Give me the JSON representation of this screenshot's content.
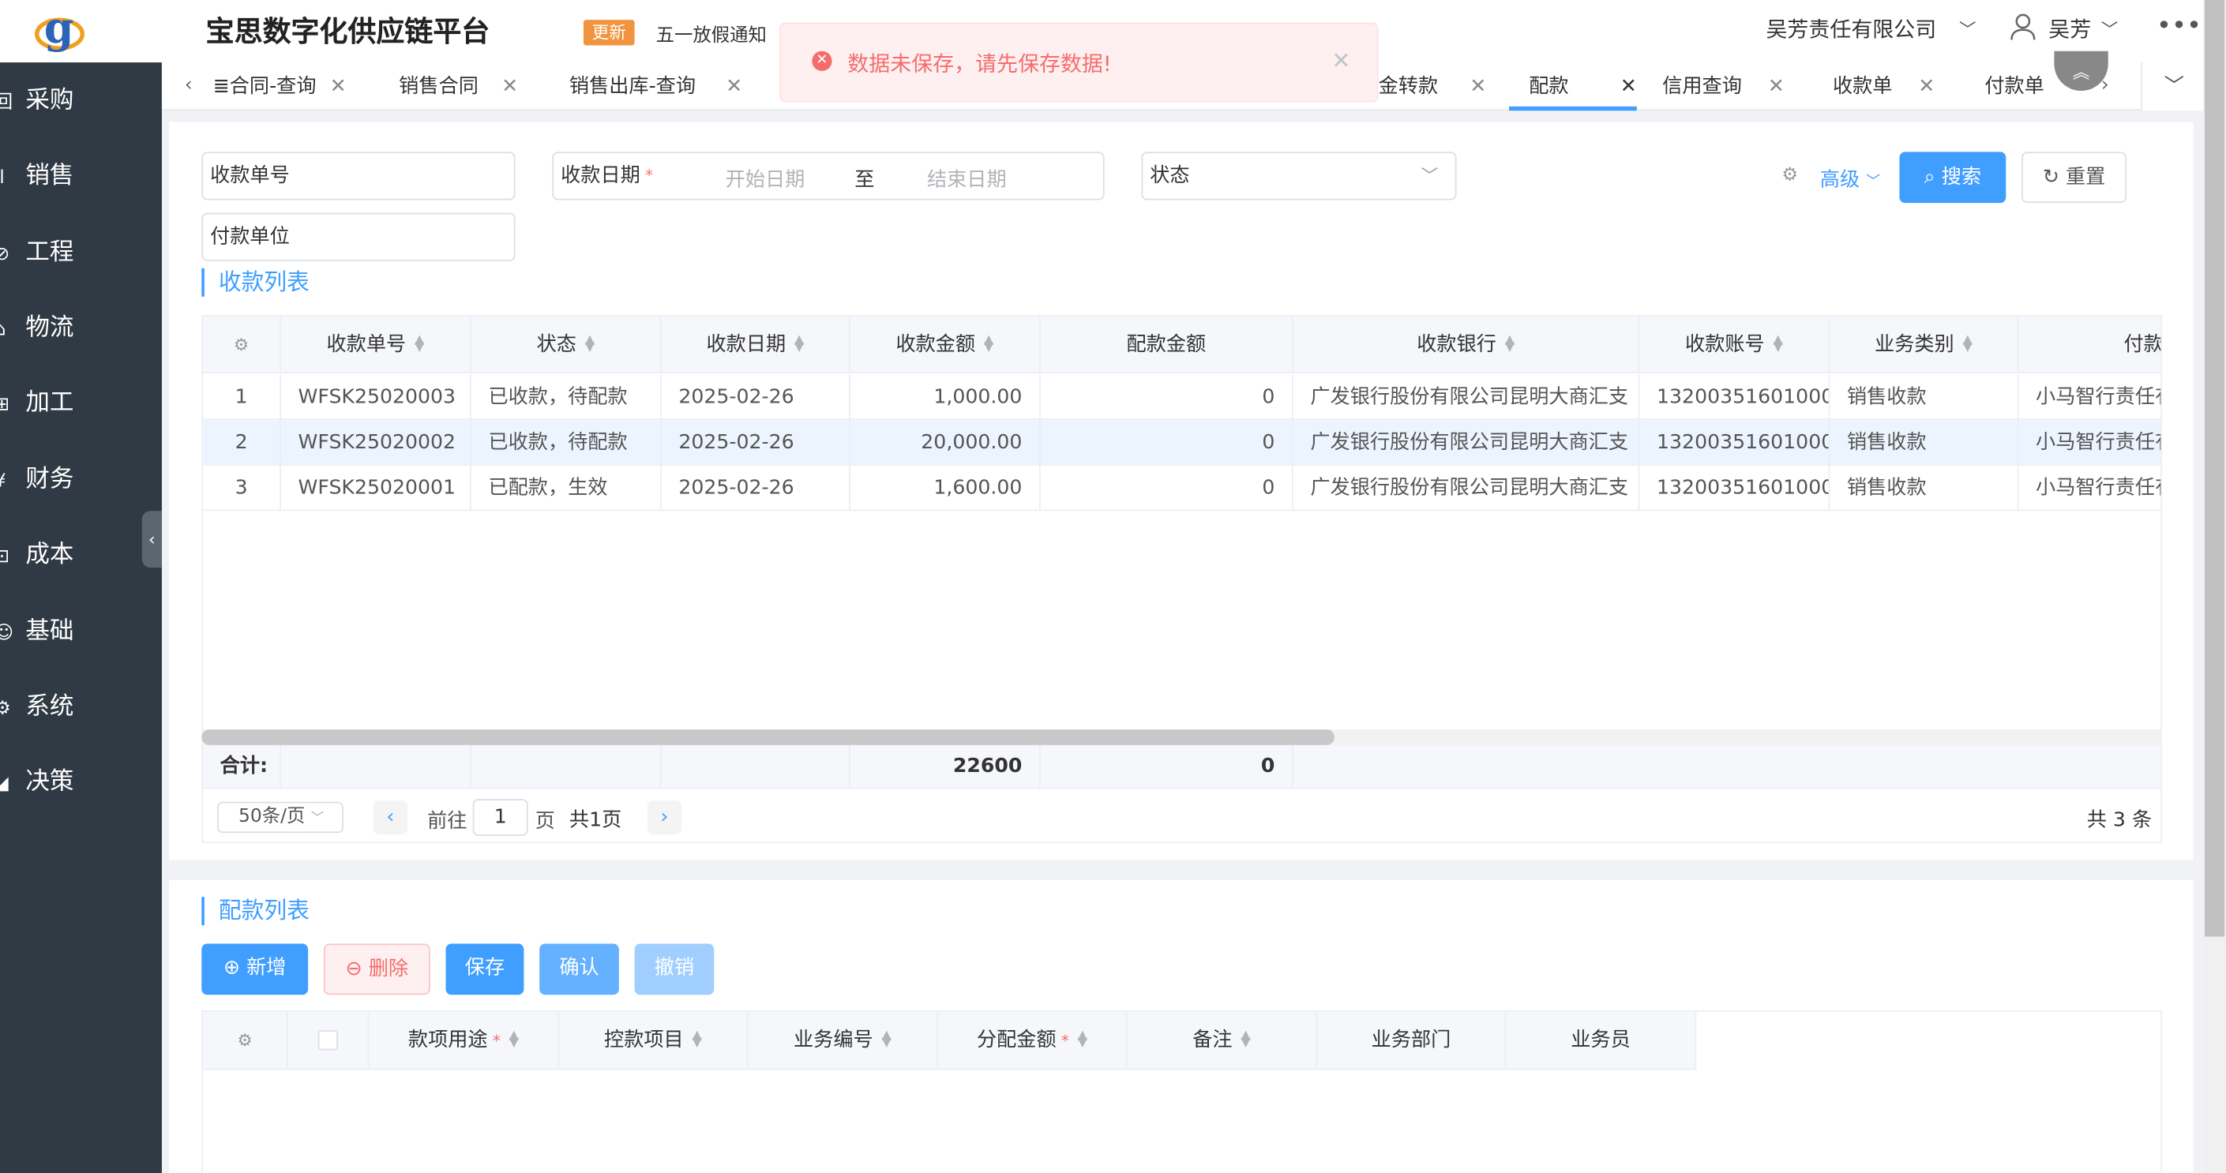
{
  "header": {
    "app_title": "宝思数字化供应链平台",
    "news_badge": "更新",
    "news_text": "五一放假通知",
    "company": "吴芳责任有限公司",
    "user": "吴芳"
  },
  "sidebar": {
    "items": [
      {
        "label": "采购",
        "icon": "purchase-icon",
        "glyph": "回"
      },
      {
        "label": "销售",
        "icon": "sales-chart-icon",
        "glyph": "ıl"
      },
      {
        "label": "工程",
        "icon": "compass-icon",
        "glyph": "⊘"
      },
      {
        "label": "物流",
        "icon": "home-icon",
        "glyph": "⌂"
      },
      {
        "label": "加工",
        "icon": "process-icon",
        "glyph": "⊞"
      },
      {
        "label": "财务",
        "icon": "yen-icon",
        "glyph": "¥"
      },
      {
        "label": "成本",
        "icon": "calendar-icon",
        "glyph": "⊡"
      },
      {
        "label": "基础",
        "icon": "smile-icon",
        "glyph": "☺"
      },
      {
        "label": "系统",
        "icon": "gear-icon",
        "glyph": "⚙"
      },
      {
        "label": "决策",
        "icon": "area-chart-icon",
        "glyph": "◢"
      }
    ]
  },
  "tabs": [
    {
      "label": "≣合同-查询"
    },
    {
      "label": "销售合同"
    },
    {
      "label": "销售出库-查询"
    },
    {
      "label": "金转款"
    },
    {
      "label": "配款",
      "active": true
    },
    {
      "label": "信用查询"
    },
    {
      "label": "收款单"
    },
    {
      "label": "付款单"
    }
  ],
  "alert": {
    "message": "数据未保存，请先保存数据!"
  },
  "filters": {
    "receipt_no_label": "收款单号",
    "date_label": "收款日期",
    "date_start_placeholder": "开始日期",
    "date_sep": "至",
    "date_end_placeholder": "结束日期",
    "status_label": "状态",
    "payer_label": "付款单位",
    "advanced": "高级",
    "search": "搜索",
    "reset": "重置"
  },
  "receipt_list": {
    "title": "收款列表",
    "columns": [
      "收款单号",
      "状态",
      "收款日期",
      "收款金额",
      "配款金额",
      "收款银行",
      "收款账号",
      "业务类别",
      "付款"
    ],
    "rows": [
      {
        "idx": "1",
        "no": "WFSK25020003",
        "status": "已收款，待配款",
        "date": "2025-02-26",
        "amount": "1,000.00",
        "alloc": "0",
        "bank": "广发银行股份有限公司昆明大商汇支",
        "account": "13200351601000",
        "type": "销售收款",
        "payer": "小马智行责任有"
      },
      {
        "idx": "2",
        "no": "WFSK25020002",
        "status": "已收款，待配款",
        "date": "2025-02-26",
        "amount": "20,000.00",
        "alloc": "0",
        "bank": "广发银行股份有限公司昆明大商汇支",
        "account": "13200351601000",
        "type": "销售收款",
        "payer": "小马智行责任有"
      },
      {
        "idx": "3",
        "no": "WFSK25020001",
        "status": "已配款，生效",
        "date": "2025-02-26",
        "amount": "1,600.00",
        "alloc": "0",
        "bank": "广发银行股份有限公司昆明大商汇支",
        "account": "13200351601000",
        "type": "销售收款",
        "payer": "小马智行责任有"
      }
    ],
    "total_label": "合计:",
    "total_amount": "22600",
    "total_alloc": "0"
  },
  "pagination": {
    "page_size": "50条/页",
    "goto_label": "前往",
    "page": "1",
    "page_unit": "页",
    "total_pages": "共1页",
    "total_count": "共 3 条"
  },
  "alloc_list": {
    "title": "配款列表",
    "buttons": {
      "add": "新增",
      "delete": "删除",
      "save": "保存",
      "confirm": "确认",
      "revoke": "撤销"
    },
    "columns": [
      "款项用途",
      "控款项目",
      "业务编号",
      "分配金额",
      "备注",
      "业务部门",
      "业务员"
    ]
  }
}
